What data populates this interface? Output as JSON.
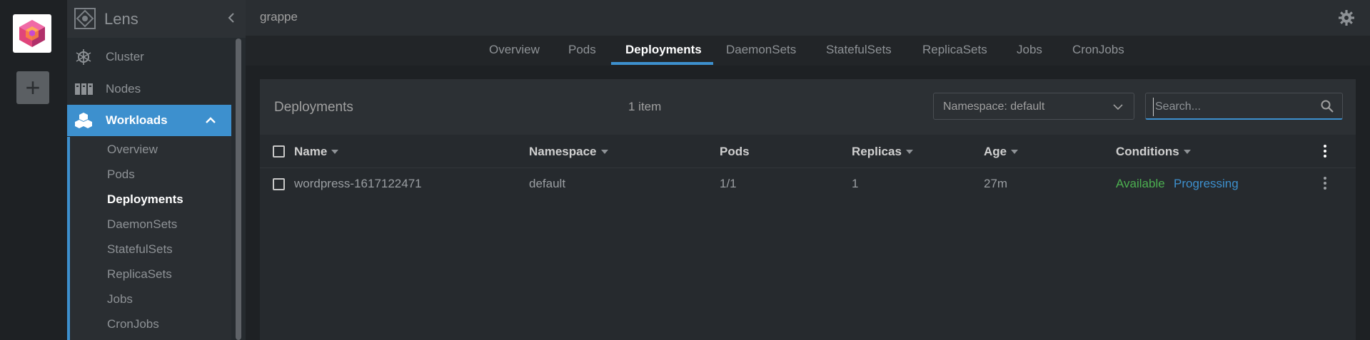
{
  "hotbar": {
    "add_label": "+"
  },
  "sidebar": {
    "title": "Lens",
    "items": [
      {
        "label": "Cluster"
      },
      {
        "label": "Nodes"
      },
      {
        "label": "Workloads"
      }
    ],
    "workloads_sub": [
      {
        "label": "Overview"
      },
      {
        "label": "Pods"
      },
      {
        "label": "Deployments"
      },
      {
        "label": "DaemonSets"
      },
      {
        "label": "StatefulSets"
      },
      {
        "label": "ReplicaSets"
      },
      {
        "label": "Jobs"
      },
      {
        "label": "CronJobs"
      }
    ]
  },
  "topbar": {
    "cluster_name": "grappe"
  },
  "tabs": [
    {
      "label": "Overview"
    },
    {
      "label": "Pods"
    },
    {
      "label": "Deployments"
    },
    {
      "label": "DaemonSets"
    },
    {
      "label": "StatefulSets"
    },
    {
      "label": "ReplicaSets"
    },
    {
      "label": "Jobs"
    },
    {
      "label": "CronJobs"
    }
  ],
  "panel": {
    "title": "Deployments",
    "count": "1 item",
    "namespace_select": "Namespace: default",
    "search_placeholder": "Search..."
  },
  "table": {
    "columns": [
      "Name",
      "Namespace",
      "Pods",
      "Replicas",
      "Age",
      "Conditions"
    ],
    "rows": [
      {
        "name": "wordpress-1617122471",
        "namespace": "default",
        "pods": "1/1",
        "replicas": "1",
        "age": "27m",
        "conditions": [
          "Available",
          "Progressing"
        ]
      }
    ]
  },
  "colors": {
    "accent": "#3d90ce",
    "available": "#4caf50",
    "progressing": "#3d90ce"
  }
}
